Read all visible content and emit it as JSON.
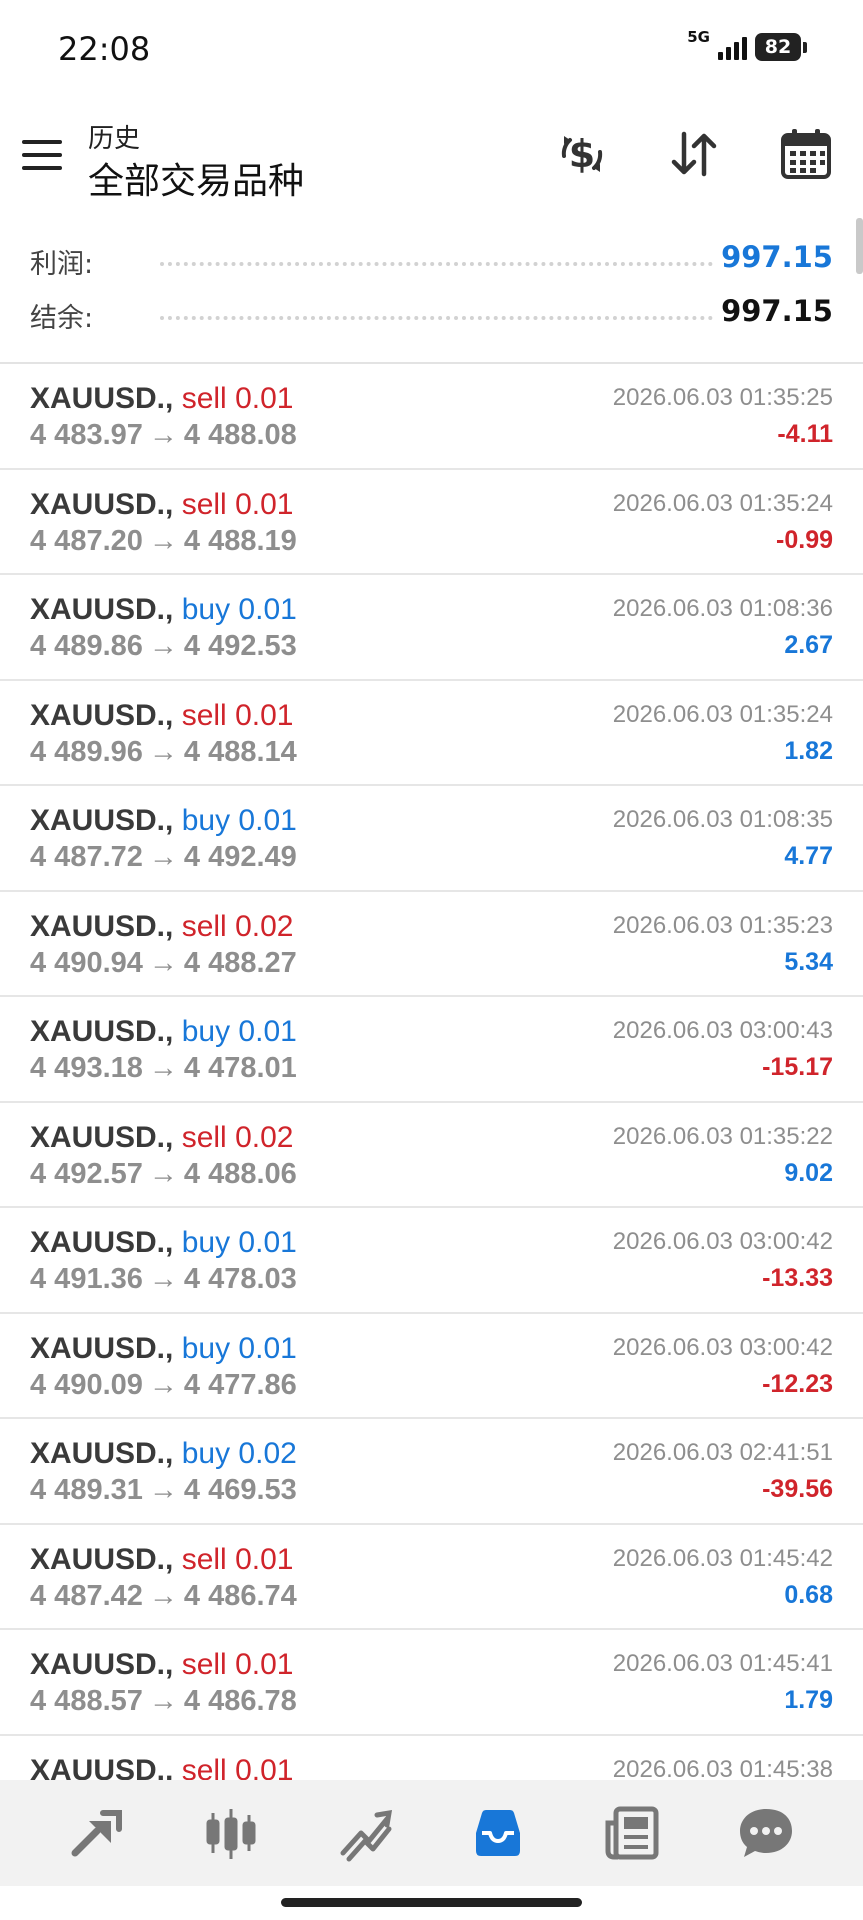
{
  "status": {
    "time": "22:08",
    "network": "5G",
    "battery": "82"
  },
  "header": {
    "subtitle": "历史",
    "title": "全部交易品种"
  },
  "summary": {
    "profit_label": "利润:",
    "profit_value": "997.15",
    "balance_label": "结余:",
    "balance_value": "997.15"
  },
  "trades": [
    {
      "symbol": "XAUUSD.,",
      "direction": "sell",
      "volume": "0.01",
      "open": "4 483.97",
      "close": "4 488.08",
      "time": "2026.06.03 01:35:25",
      "profit": "-4.11"
    },
    {
      "symbol": "XAUUSD.,",
      "direction": "sell",
      "volume": "0.01",
      "open": "4 487.20",
      "close": "4 488.19",
      "time": "2026.06.03 01:35:24",
      "profit": "-0.99"
    },
    {
      "symbol": "XAUUSD.,",
      "direction": "buy",
      "volume": "0.01",
      "open": "4 489.86",
      "close": "4 492.53",
      "time": "2026.06.03 01:08:36",
      "profit": "2.67"
    },
    {
      "symbol": "XAUUSD.,",
      "direction": "sell",
      "volume": "0.01",
      "open": "4 489.96",
      "close": "4 488.14",
      "time": "2026.06.03 01:35:24",
      "profit": "1.82"
    },
    {
      "symbol": "XAUUSD.,",
      "direction": "buy",
      "volume": "0.01",
      "open": "4 487.72",
      "close": "4 492.49",
      "time": "2026.06.03 01:08:35",
      "profit": "4.77"
    },
    {
      "symbol": "XAUUSD.,",
      "direction": "sell",
      "volume": "0.02",
      "open": "4 490.94",
      "close": "4 488.27",
      "time": "2026.06.03 01:35:23",
      "profit": "5.34"
    },
    {
      "symbol": "XAUUSD.,",
      "direction": "buy",
      "volume": "0.01",
      "open": "4 493.18",
      "close": "4 478.01",
      "time": "2026.06.03 03:00:43",
      "profit": "-15.17"
    },
    {
      "symbol": "XAUUSD.,",
      "direction": "sell",
      "volume": "0.02",
      "open": "4 492.57",
      "close": "4 488.06",
      "time": "2026.06.03 01:35:22",
      "profit": "9.02"
    },
    {
      "symbol": "XAUUSD.,",
      "direction": "buy",
      "volume": "0.01",
      "open": "4 491.36",
      "close": "4 478.03",
      "time": "2026.06.03 03:00:42",
      "profit": "-13.33"
    },
    {
      "symbol": "XAUUSD.,",
      "direction": "buy",
      "volume": "0.01",
      "open": "4 490.09",
      "close": "4 477.86",
      "time": "2026.06.03 03:00:42",
      "profit": "-12.23"
    },
    {
      "symbol": "XAUUSD.,",
      "direction": "buy",
      "volume": "0.02",
      "open": "4 489.31",
      "close": "4 469.53",
      "time": "2026.06.03 02:41:51",
      "profit": "-39.56"
    },
    {
      "symbol": "XAUUSD.,",
      "direction": "sell",
      "volume": "0.01",
      "open": "4 487.42",
      "close": "4 486.74",
      "time": "2026.06.03 01:45:42",
      "profit": "0.68"
    },
    {
      "symbol": "XAUUSD.,",
      "direction": "sell",
      "volume": "0.01",
      "open": "4 488.57",
      "close": "4 486.78",
      "time": "2026.06.03 01:45:41",
      "profit": "1.79"
    },
    {
      "symbol": "XAUUSD.,",
      "direction": "sell",
      "volume": "0.01",
      "open": "",
      "close": "",
      "time": "2026.06.03 01:45:38",
      "profit": ""
    }
  ],
  "arrow": "→",
  "colors": {
    "sell": "#d0242b",
    "buy": "#1877d8",
    "negative": "#d0242b",
    "positive": "#1877d8",
    "active_tab": "#1877d8"
  },
  "toolbar_icons": [
    "currency-exchange-icon",
    "sort-icon",
    "calendar-icon"
  ],
  "nav": [
    {
      "icon": "trade-arrows-icon",
      "active": false
    },
    {
      "icon": "candlestick-icon",
      "active": false
    },
    {
      "icon": "chart-lines-icon",
      "active": false
    },
    {
      "icon": "inbox-history-icon",
      "active": true
    },
    {
      "icon": "news-icon",
      "active": false
    },
    {
      "icon": "chat-bubble-icon",
      "active": false
    }
  ]
}
